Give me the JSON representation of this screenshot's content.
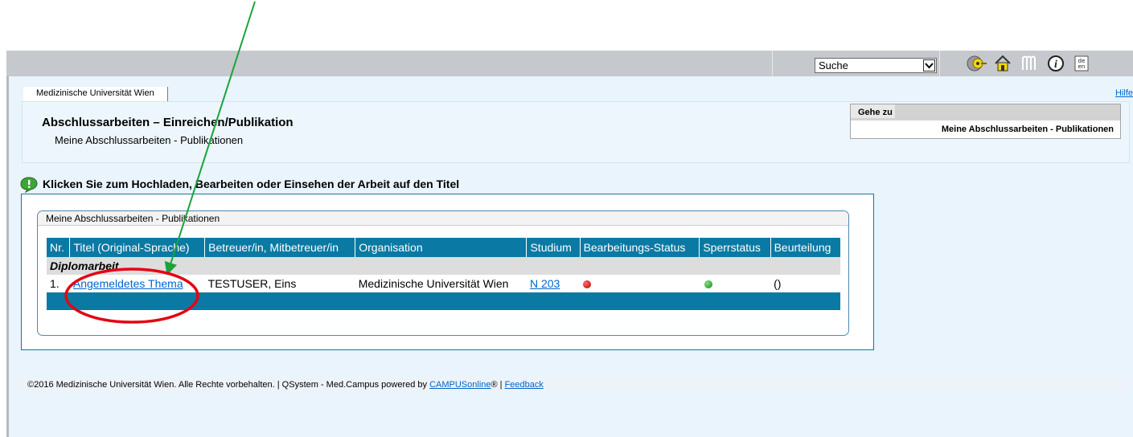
{
  "topbar": {
    "search_select_value": "Suche",
    "icons": [
      "key-icon",
      "home-icon",
      "logo-icon",
      "info-icon",
      "language-icon"
    ],
    "language_label": "de\nen"
  },
  "header": {
    "institution_tab": "Medizinische Universität Wien",
    "help_link": "Hilfe",
    "page_title": "Abschlussarbeiten – Einreichen/Publikation",
    "page_subtitle": "Meine Abschlussarbeiten - Publikationen",
    "goto": {
      "label": "Gehe zu",
      "item": "Meine Abschlussarbeiten - Publikationen"
    }
  },
  "hint": "Klicken Sie zum Hochladen, Bearbeiten oder Einsehen der Arbeit auf den Titel",
  "panel": {
    "title": "Meine Abschlussarbeiten - Publikationen",
    "columns": [
      "Nr.",
      "Titel (Original-Sprache)",
      "Betreuer/in, Mitbetreuer/in",
      "Organisation",
      "Studium",
      "Bearbeitungs-Status",
      "Sperrstatus",
      "Beurteilung"
    ],
    "group_label": "Diplomarbeit",
    "rows": [
      {
        "nr": "1.",
        "titel": "Angemeldetes Thema",
        "betreuer": "TESTUSER, Eins",
        "organisation": "Medizinische Universität Wien",
        "studium": "N 203",
        "bearbeitungs_status": "red",
        "sperrstatus": "green",
        "beurteilung": "()"
      }
    ]
  },
  "footer": {
    "prefix": "©2016 Medizinische Universität Wien. Alle Rechte vorbehalten. | QSystem - Med.Campus powered by ",
    "campus_link": "CAMPUSonline",
    "reg": "® | ",
    "feedback_link": "Feedback"
  },
  "colors": {
    "header_blue": "#0a7aa4",
    "status_red": "#c0000a",
    "status_green": "#2ea02e",
    "annotation_red": "#e30613",
    "annotation_green": "#1aa33a"
  }
}
